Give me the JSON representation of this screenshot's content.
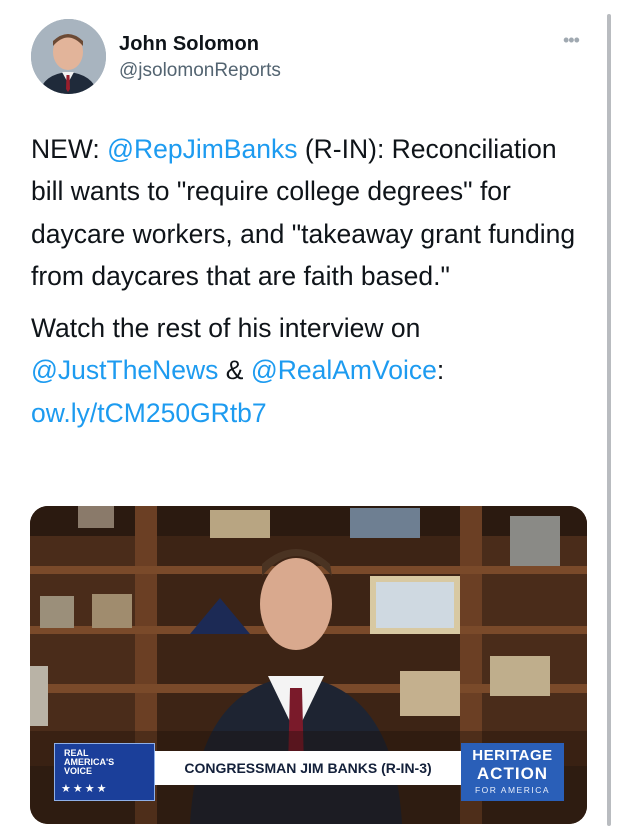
{
  "author": {
    "display_name": "John Solomon",
    "handle": "@jsolomonReports",
    "avatar_icon": "person-portrait-icon"
  },
  "more_icon": "ellipsis-icon",
  "tweet": {
    "p1_lead": "NEW: ",
    "p1_mention": "@RepJimBanks",
    "p1_body": " (R-IN): Reconciliation bill wants to \"require college degrees\" for daycare workers, and \"takeaway grant funding from daycares that are faith based.\"",
    "p2_lead": "Watch the rest of his interview on ",
    "p2_mention1": "@JustTheNews",
    "p2_amp": " & ",
    "p2_mention2": "@RealAmVoice",
    "p2_colon": ": ",
    "p2_link": "ow.ly/tCM250GRtb7"
  },
  "video": {
    "lower_third_brand": "REAL AMERICA'S VOICE",
    "lower_third_stars": "★★★★",
    "lower_third_name": "CONGRESSMAN JIM BANKS (R-IN-3)",
    "heritage_line1": "HERITAGE",
    "heritage_line2": "ACTION",
    "heritage_line3": "FOR AMERICA"
  },
  "colors": {
    "link": "#1d9bf0",
    "text": "#0f1419",
    "secondary": "#536471",
    "shelf_wood": "#5a3420",
    "brand_blue": "#1b3f9a"
  }
}
